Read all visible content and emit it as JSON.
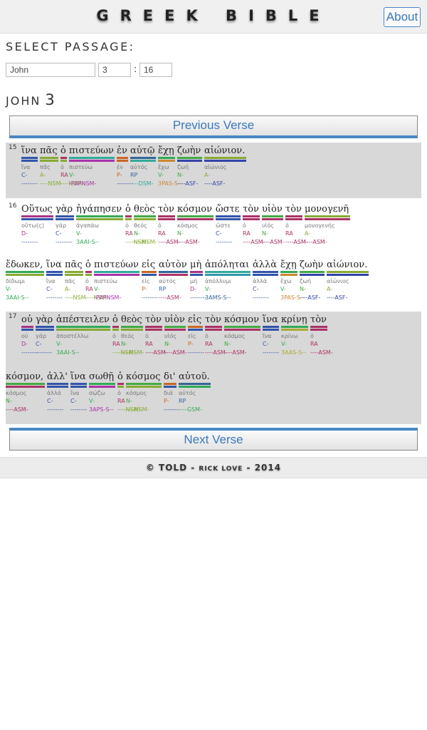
{
  "header": {
    "title": "GREEK BIBLE",
    "about_label": "About"
  },
  "selector": {
    "label": "SELECT PASSAGE:",
    "book": "John",
    "chapter": "3",
    "colon": ":",
    "verse": "16"
  },
  "chapter_heading": {
    "book": "JOHN",
    "chapter": "3"
  },
  "prev_label": "Previous Verse",
  "next_label": "Next Verse",
  "footer": {
    "copyright": "© TOLD",
    "sep1": "-",
    "author": "RICK LOVE",
    "sep2": "-",
    "year": "2014"
  },
  "colors": {
    "C": "#3355aa",
    "A": "#88aa33",
    "RA": "#aa3366",
    "V": "#33aa55",
    "P": "#cc6622",
    "RP": "#336699",
    "N": "#44aa44",
    "D": "#aa3388",
    "ASM": "#aa3366",
    "NSM": "#88aa33",
    "GSM": "#33aa55"
  },
  "verses": [
    {
      "num": "15",
      "lines": [
        [
          {
            "g": "ἵνα",
            "lex": "ἵνα",
            "pos": "C-",
            "parse": "--------",
            "b1": "#3355aa",
            "b2": "#3355aa",
            "pc": "#3355aa",
            "rc": "#3355aa"
          },
          {
            "g": "πᾶς",
            "lex": "πᾶς",
            "pos": "A-",
            "parse": "----NSM-",
            "b1": "#88aa33",
            "b2": "#88aa33",
            "pc": "#88aa33",
            "rc": "#88aa33"
          },
          {
            "g": "ὁ",
            "lex": "ὁ",
            "pos": "RA",
            "parse": "----NSM-",
            "b1": "#aa3366",
            "b2": "#88aa33",
            "pc": "#aa3366",
            "rc": "#88aa33"
          },
          {
            "g": "πιστεύων",
            "lex": "πιστεύω",
            "pos": "V-",
            "parse": "-PAPNSM-",
            "b1": "#33aa99",
            "b2": "#aa33aa",
            "pc": "#33aa55",
            "rc": "#aa33aa"
          },
          {
            "g": "ἐν",
            "lex": "ἐν",
            "pos": "P-",
            "parse": "--------",
            "b1": "#cc6622",
            "b2": "#cc6622",
            "pc": "#cc6622",
            "rc": "#3355aa"
          },
          {
            "g": "αὐτῷ",
            "lex": "αὐτός",
            "pos": "RP",
            "parse": "----DSM-",
            "b1": "#336699",
            "b2": "#33aa99",
            "pc": "#336699",
            "rc": "#33aa99"
          },
          {
            "g": "ἔχῃ",
            "lex": "ἔχω",
            "pos": "V-",
            "parse": "3PAS-S--",
            "b1": "#33aa55",
            "b2": "#cc8833",
            "pc": "#33aa55",
            "rc": "#cc8833"
          },
          {
            "g": "ζωὴν",
            "lex": "ζωή",
            "pos": "N-",
            "parse": "----ASF-",
            "b1": "#44aa44",
            "b2": "#3344aa",
            "pc": "#44aa44",
            "rc": "#3344aa"
          },
          {
            "g": "αἰώνιον.",
            "lex": "αἰώνιος",
            "pos": "A-",
            "parse": "----ASF-",
            "b1": "#88aa33",
            "b2": "#3344aa",
            "pc": "#88aa33",
            "rc": "#3344aa"
          }
        ]
      ]
    },
    {
      "num": "16",
      "lines": [
        [
          {
            "g": "Οὕτως",
            "lex": "οὕτω(ς)",
            "pos": "D-",
            "parse": "--------",
            "b1": "#aa3388",
            "b2": "#3355aa",
            "pc": "#aa3388",
            "rc": "#3355aa"
          },
          {
            "g": "γὰρ",
            "lex": "γάρ",
            "pos": "C-",
            "parse": "--------",
            "b1": "#3355aa",
            "b2": "#3355aa",
            "pc": "#3355aa",
            "rc": "#3355aa"
          },
          {
            "g": "ἠγάπησεν",
            "lex": "ἀγαπάω",
            "pos": "V-",
            "parse": "3AAI-S--",
            "b1": "#33aa55",
            "b2": "#88aa33",
            "pc": "#33aa55",
            "rc": "#33aa55"
          },
          {
            "g": "ὁ",
            "lex": "ὁ",
            "pos": "RA",
            "parse": "----NSM-",
            "b1": "#aa3366",
            "b2": "#88aa33",
            "pc": "#aa3366",
            "rc": "#88aa33"
          },
          {
            "g": "θεὸς",
            "lex": "θεός",
            "pos": "N-",
            "parse": "----NSM-",
            "b1": "#44aa44",
            "b2": "#88aa33",
            "pc": "#44aa44",
            "rc": "#88aa33"
          },
          {
            "g": "τὸν",
            "lex": "ὁ",
            "pos": "RA",
            "parse": "----ASM-",
            "b1": "#aa3366",
            "b2": "#aa3366",
            "pc": "#aa3366",
            "rc": "#aa3366"
          },
          {
            "g": "κόσμον",
            "lex": "κόσμος",
            "pos": "N-",
            "parse": "----ASM-",
            "b1": "#44aa44",
            "b2": "#aa3366",
            "pc": "#44aa44",
            "rc": "#aa3366"
          },
          {
            "g": "ὥστε",
            "lex": "ὥστε",
            "pos": "C-",
            "parse": "--------",
            "b1": "#3355aa",
            "b2": "#3355aa",
            "pc": "#3355aa",
            "rc": "#3355aa"
          },
          {
            "g": "τὸν",
            "lex": "ὁ",
            "pos": "RA",
            "parse": "----ASM-",
            "b1": "#aa3366",
            "b2": "#aa3366",
            "pc": "#aa3366",
            "rc": "#aa3366"
          },
          {
            "g": "υἱὸν",
            "lex": "υἱός",
            "pos": "N-",
            "parse": "----ASM-",
            "b1": "#44aa44",
            "b2": "#aa3366",
            "pc": "#44aa44",
            "rc": "#aa3366"
          },
          {
            "g": "τὸν",
            "lex": "ὁ",
            "pos": "RA",
            "parse": "----ASM-",
            "b1": "#aa3366",
            "b2": "#aa3366",
            "pc": "#aa3366",
            "rc": "#aa3366"
          },
          {
            "g": "μονογενῆ",
            "lex": "μονογενής",
            "pos": "A-",
            "parse": "----ASM-",
            "b1": "#88aa33",
            "b2": "#aa3366",
            "pc": "#88aa33",
            "rc": "#aa3366"
          }
        ],
        [
          {
            "g": "ἔδωκεν,",
            "lex": "δίδωμι",
            "pos": "V-",
            "parse": "3AAI-S--",
            "b1": "#33aa55",
            "b2": "#88aa33",
            "pc": "#33aa55",
            "rc": "#33aa55"
          },
          {
            "g": "ἵνα",
            "lex": "ἵνα",
            "pos": "C-",
            "parse": "--------",
            "b1": "#3355aa",
            "b2": "#3355aa",
            "pc": "#3355aa",
            "rc": "#3355aa"
          },
          {
            "g": "πᾶς",
            "lex": "πᾶς",
            "pos": "A-",
            "parse": "----NSM-",
            "b1": "#88aa33",
            "b2": "#88aa33",
            "pc": "#88aa33",
            "rc": "#88aa33"
          },
          {
            "g": "ὁ",
            "lex": "ὁ",
            "pos": "RA",
            "parse": "----NSM-",
            "b1": "#aa3366",
            "b2": "#88aa33",
            "pc": "#aa3366",
            "rc": "#88aa33"
          },
          {
            "g": "πιστεύων",
            "lex": "πιστεύω",
            "pos": "V-",
            "parse": "-PAPNSM-",
            "b1": "#33aa99",
            "b2": "#aa33aa",
            "pc": "#33aa55",
            "rc": "#aa33aa"
          },
          {
            "g": "εἰς",
            "lex": "εἰς",
            "pos": "P-",
            "parse": "--------",
            "b1": "#cc6622",
            "b2": "#3355aa",
            "pc": "#cc6622",
            "rc": "#3355aa"
          },
          {
            "g": "αὐτὸν",
            "lex": "αὐτός",
            "pos": "RP",
            "parse": "----ASM-",
            "b1": "#336699",
            "b2": "#aa3366",
            "pc": "#336699",
            "rc": "#aa3366"
          },
          {
            "g": "μὴ",
            "lex": "μή",
            "pos": "D-",
            "parse": "--------",
            "b1": "#aa3388",
            "b2": "#3355aa",
            "pc": "#aa3388",
            "rc": "#3355aa"
          },
          {
            "g": "ἀπόληται",
            "lex": "ἀπόλλυμι",
            "pos": "V-",
            "parse": "3AMS-S--",
            "b1": "#33aa99",
            "b2": "#3399aa",
            "pc": "#33aa55",
            "rc": "#336699"
          },
          {
            "g": "ἀλλὰ",
            "lex": "ἀλλά",
            "pos": "C-",
            "parse": "--------",
            "b1": "#3355aa",
            "b2": "#3355aa",
            "pc": "#3355aa",
            "rc": "#3355aa"
          },
          {
            "g": "ἔχῃ",
            "lex": "ἔχω",
            "pos": "V-",
            "parse": "3PAS-S--",
            "b1": "#33aa55",
            "b2": "#cc8833",
            "pc": "#33aa55",
            "rc": "#cc8833"
          },
          {
            "g": "ζωὴν",
            "lex": "ζωή",
            "pos": "N-",
            "parse": "----ASF-",
            "b1": "#44aa44",
            "b2": "#3344aa",
            "pc": "#44aa44",
            "rc": "#3344aa"
          },
          {
            "g": "αἰώνιον.",
            "lex": "αἰώνιος",
            "pos": "A-",
            "parse": "----ASF-",
            "b1": "#88aa33",
            "b2": "#3344aa",
            "pc": "#88aa33",
            "rc": "#3344aa"
          }
        ]
      ]
    },
    {
      "num": "17",
      "lines": [
        [
          {
            "g": "οὐ",
            "lex": "οὐ",
            "pos": "D-",
            "parse": "--------",
            "b1": "#aa3388",
            "b2": "#3355aa",
            "pc": "#aa3388",
            "rc": "#3355aa"
          },
          {
            "g": "γὰρ",
            "lex": "γάρ",
            "pos": "C-",
            "parse": "--------",
            "b1": "#3355aa",
            "b2": "#3355aa",
            "pc": "#3355aa",
            "rc": "#3355aa"
          },
          {
            "g": "ἀπέστειλεν",
            "lex": "ἀποστέλλω",
            "pos": "V-",
            "parse": "3AAI-S--",
            "b1": "#33aa55",
            "b2": "#88aa33",
            "pc": "#33aa55",
            "rc": "#33aa55"
          },
          {
            "g": "ὁ",
            "lex": "ὁ",
            "pos": "RA",
            "parse": "----NSM-",
            "b1": "#aa3366",
            "b2": "#88aa33",
            "pc": "#aa3366",
            "rc": "#88aa33"
          },
          {
            "g": "θεὸς",
            "lex": "θεός",
            "pos": "N-",
            "parse": "----NSM-",
            "b1": "#44aa44",
            "b2": "#88aa33",
            "pc": "#44aa44",
            "rc": "#88aa33"
          },
          {
            "g": "τὸν",
            "lex": "ὁ",
            "pos": "RA",
            "parse": "----ASM-",
            "b1": "#aa3366",
            "b2": "#aa3366",
            "pc": "#aa3366",
            "rc": "#aa3366"
          },
          {
            "g": "υἱὸν",
            "lex": "υἱός",
            "pos": "N-",
            "parse": "----ASM-",
            "b1": "#44aa44",
            "b2": "#aa3366",
            "pc": "#44aa44",
            "rc": "#aa3366"
          },
          {
            "g": "εἰς",
            "lex": "εἰς",
            "pos": "P-",
            "parse": "--------",
            "b1": "#cc6622",
            "b2": "#3355aa",
            "pc": "#cc6622",
            "rc": "#3355aa"
          },
          {
            "g": "τὸν",
            "lex": "ὁ",
            "pos": "RA",
            "parse": "----ASM-",
            "b1": "#aa3366",
            "b2": "#aa3366",
            "pc": "#aa3366",
            "rc": "#aa3366"
          },
          {
            "g": "κόσμον",
            "lex": "κόσμος",
            "pos": "N-",
            "parse": "----ASM-",
            "b1": "#44aa44",
            "b2": "#aa3366",
            "pc": "#44aa44",
            "rc": "#aa3366"
          },
          {
            "g": "ἵνα",
            "lex": "ἵνα",
            "pos": "C-",
            "parse": "--------",
            "b1": "#3355aa",
            "b2": "#3355aa",
            "pc": "#3355aa",
            "rc": "#3355aa"
          },
          {
            "g": "κρίνῃ",
            "lex": "κρίνω",
            "pos": "V-",
            "parse": "3AAS-S--",
            "b1": "#33aa55",
            "b2": "#aaaa33",
            "pc": "#33aa55",
            "rc": "#aaaa33"
          },
          {
            "g": "τὸν",
            "lex": "ὁ",
            "pos": "RA",
            "parse": "----ASM-",
            "b1": "#aa3366",
            "b2": "#aa3366",
            "pc": "#aa3366",
            "rc": "#aa3366"
          }
        ],
        [
          {
            "g": "κόσμον,",
            "lex": "κόσμος",
            "pos": "N-",
            "parse": "----ASM-",
            "b1": "#44aa44",
            "b2": "#aa3366",
            "pc": "#44aa44",
            "rc": "#aa3366"
          },
          {
            "g": "ἀλλ'",
            "lex": "ἀλλά",
            "pos": "C-",
            "parse": "--------",
            "b1": "#3355aa",
            "b2": "#3355aa",
            "pc": "#3355aa",
            "rc": "#3355aa"
          },
          {
            "g": "ἵνα",
            "lex": "ἵνα",
            "pos": "C-",
            "parse": "--------",
            "b1": "#3355aa",
            "b2": "#3355aa",
            "pc": "#3355aa",
            "rc": "#3355aa"
          },
          {
            "g": "σωθῇ",
            "lex": "σῴζω",
            "pos": "V-",
            "parse": "3APS-S--",
            "b1": "#33aa55",
            "b2": "#aa33aa",
            "pc": "#33aa55",
            "rc": "#aa33aa"
          },
          {
            "g": "ὁ",
            "lex": "ὁ",
            "pos": "RA",
            "parse": "----NSM-",
            "b1": "#aa3366",
            "b2": "#88aa33",
            "pc": "#aa3366",
            "rc": "#88aa33"
          },
          {
            "g": "κόσμος",
            "lex": "κόσμος",
            "pos": "N-",
            "parse": "----NSM-",
            "b1": "#44aa44",
            "b2": "#88aa33",
            "pc": "#44aa44",
            "rc": "#88aa33"
          },
          {
            "g": "δι'",
            "lex": "διά",
            "pos": "P-",
            "parse": "--------",
            "b1": "#cc6622",
            "b2": "#3355aa",
            "pc": "#cc6622",
            "rc": "#3355aa"
          },
          {
            "g": "αὐτοῦ.",
            "lex": "αὐτός",
            "pos": "RP",
            "parse": "----GSM-",
            "b1": "#336699",
            "b2": "#33aa55",
            "pc": "#336699",
            "rc": "#33aa55"
          }
        ]
      ]
    }
  ]
}
